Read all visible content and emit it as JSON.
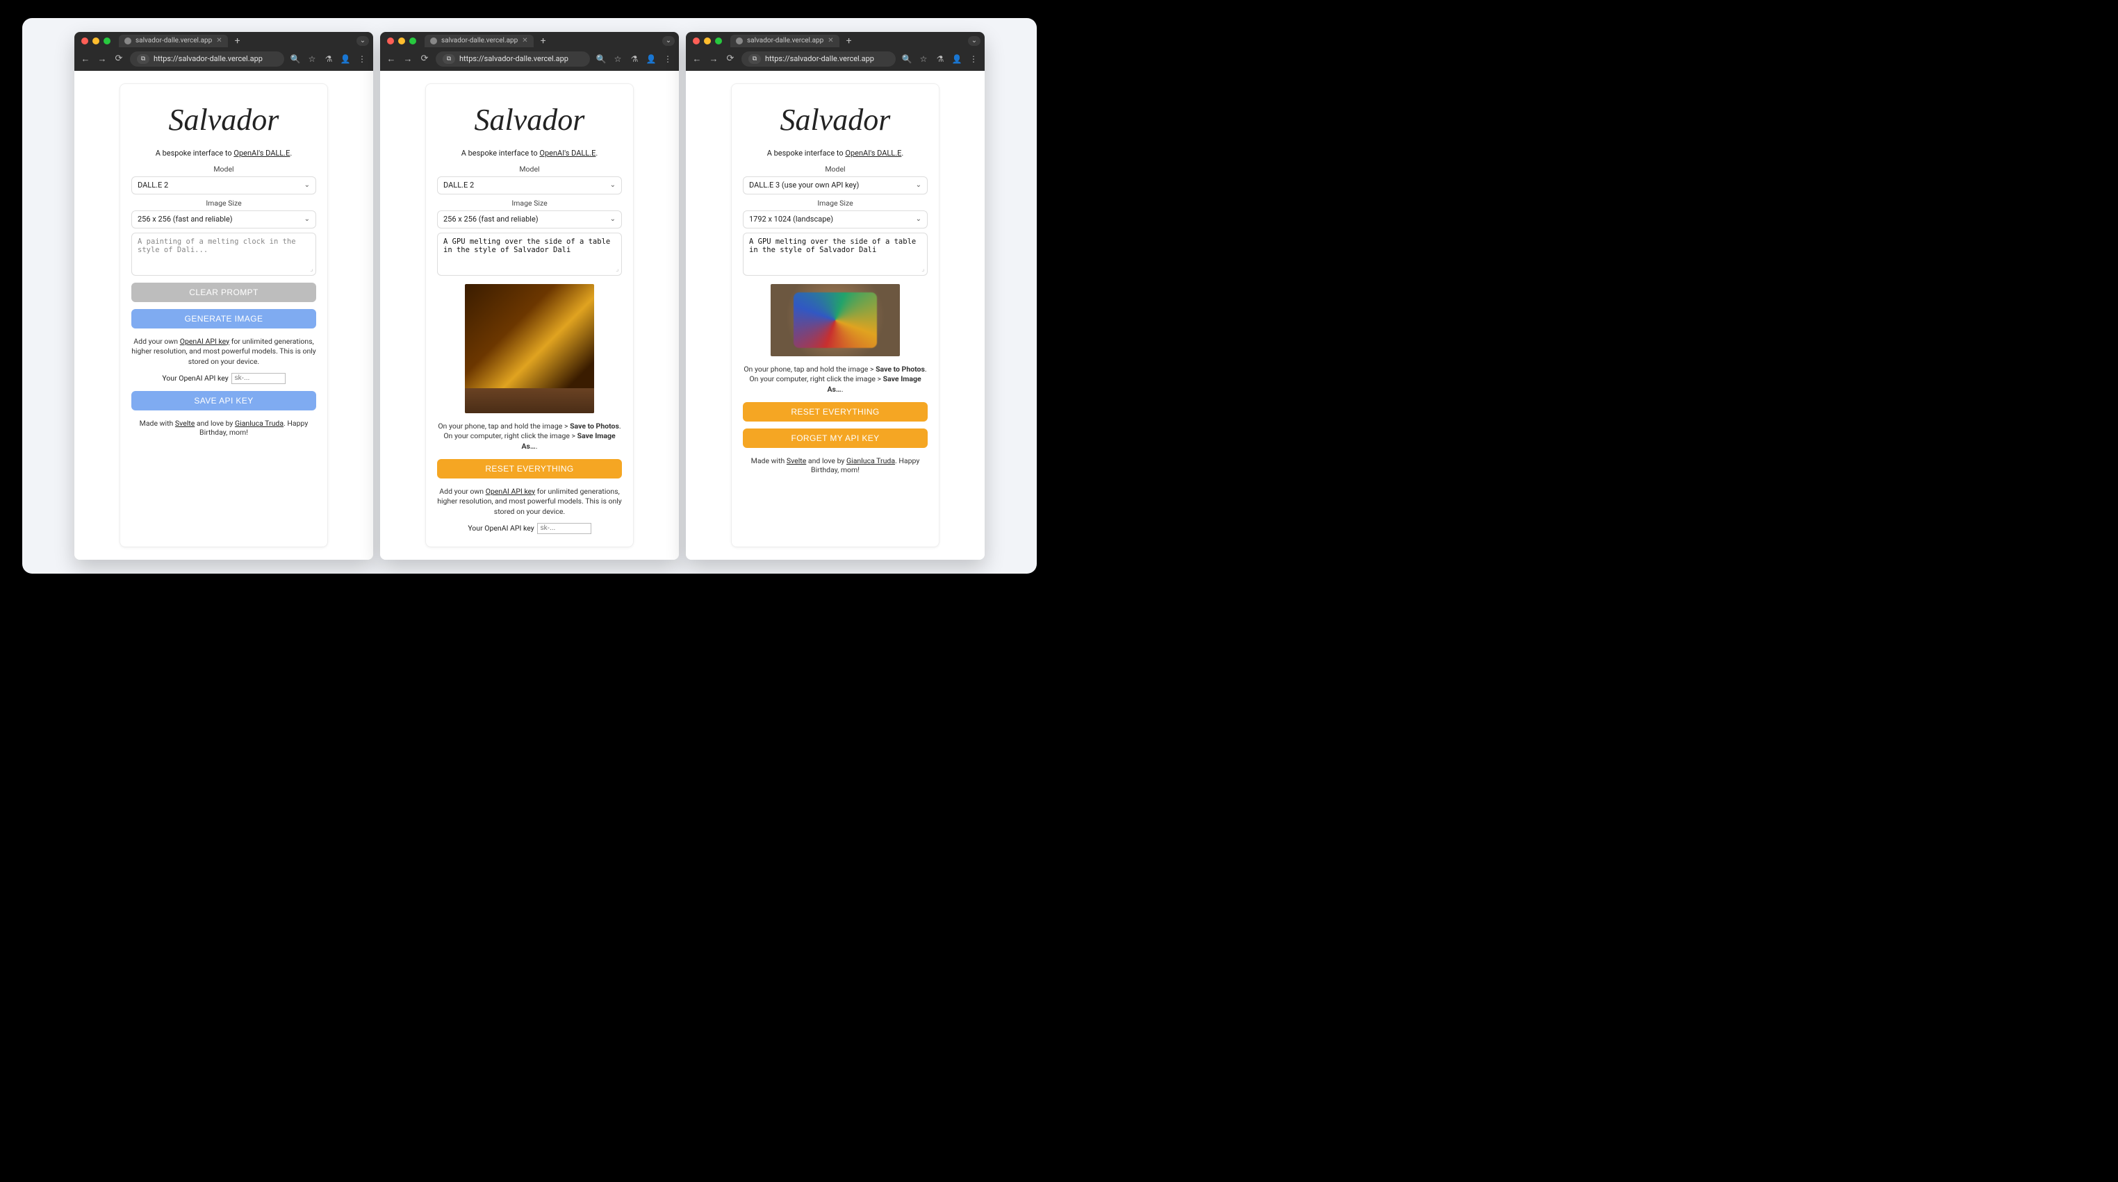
{
  "browserUrl": "https://salvador-dalle.vercel.app",
  "tabTitle": "salvador-dalle.vercel.app",
  "app": {
    "title": "Salvador",
    "subPrefix": "A bespoke interface to ",
    "subLinkText": "OpenAI's DALL.E",
    "subSuffix": ".",
    "labels": {
      "model": "Model",
      "imageSize": "Image Size",
      "apiKey": "Your OpenAI API key"
    },
    "placeholders": {
      "prompt": "A painting of a melting clock in the style of Dali...",
      "apikey": "sk-..."
    },
    "buttons": {
      "clearPrompt": "CLEAR PROMPT",
      "generate": "GENERATE IMAGE",
      "saveKey": "SAVE API KEY",
      "resetEverything": "RESET EVERYTHING",
      "forgetKey": "FORGET MY API KEY"
    },
    "apiNote": {
      "prefix": "Add your own ",
      "link": "OpenAI API key",
      "suffix": " for unlimited generations, higher resolution, and most powerful models. This is only stored on your device."
    },
    "saveNote": {
      "p1": "On your phone, tap and hold the image > ",
      "b1": "Save to Photos",
      "p2": ". On your computer, right click the image > ",
      "b2": "Save Image As…",
      "p3": "."
    },
    "footer": {
      "p1": "Made with ",
      "link1": "Svelte",
      "p2": " and love by ",
      "link2": "Gianluca Truda",
      "p3": ". Happy Birthday, mom!"
    }
  },
  "panels": [
    {
      "model": "DALL.E 2",
      "size": "256 x 256 (fast and reliable)",
      "prompt": ""
    },
    {
      "model": "DALL.E 2",
      "size": "256 x 256 (fast and reliable)",
      "prompt": "A GPU melting over the side of a table in the style of Salvador Dali"
    },
    {
      "model": "DALL.E 3 (use your own API key)",
      "size": "1792 x 1024 (landscape)",
      "prompt": "A GPU melting over the side of a table in the style of Salvador Dali"
    }
  ]
}
